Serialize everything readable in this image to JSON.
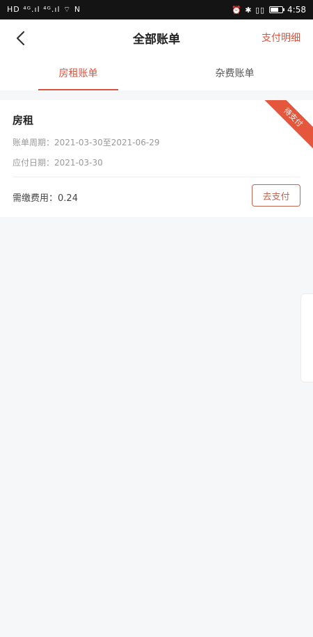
{
  "statusbar": {
    "left_icons": "HD ⁴ᴳ.ıl ⁴ᴳ.ıl ⌔ N",
    "right_icons": "⏰ ✱ ▯▯",
    "time": "4:58"
  },
  "header": {
    "back_icon": "chevron-left-icon",
    "title": "全部账单",
    "detail_link": "支付明细"
  },
  "tabs": [
    {
      "label": "房租账单",
      "active": true
    },
    {
      "label": "杂费账单",
      "active": false
    }
  ],
  "bill": {
    "title": "房租",
    "status_ribbon": "待支付",
    "period_label": "账单周期",
    "period_value": "2021-03-30至2021-06-29",
    "due_label": "应付日期",
    "due_value": "2021-03-30",
    "fee_label": "需缴费用",
    "fee_value": "0.24",
    "pay_button": "去支付"
  },
  "colors": {
    "accent": "#d9533e",
    "ribbon": "#e5573c",
    "background": "#f6f7f9"
  }
}
